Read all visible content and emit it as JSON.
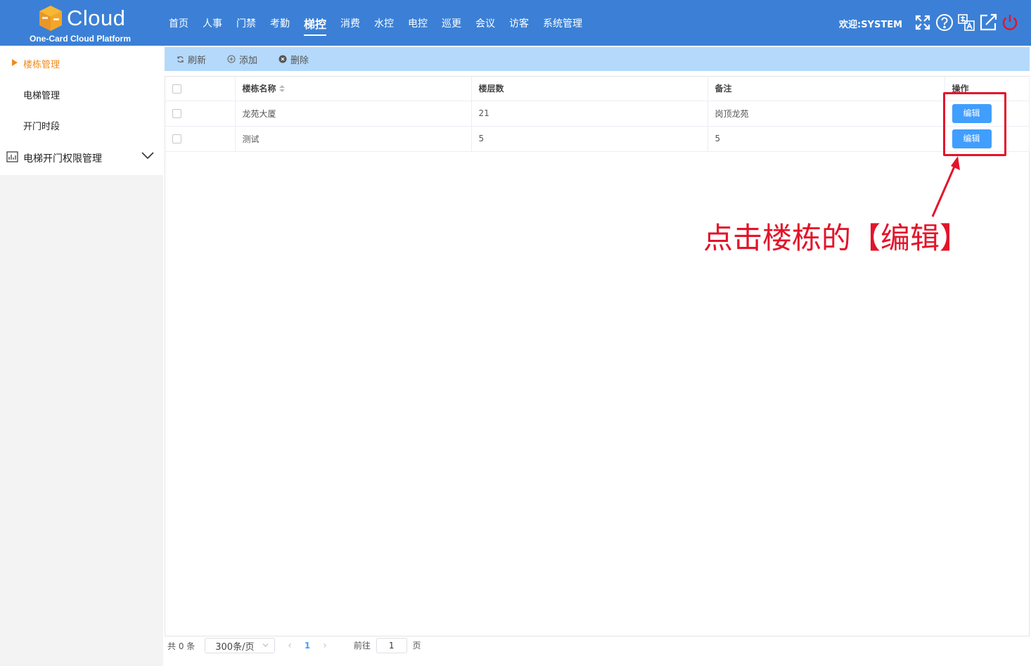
{
  "header": {
    "logo_word": "Cloud",
    "logo_sub": "One-Card Cloud Platform",
    "nav": [
      "首页",
      "人事",
      "门禁",
      "考勤",
      "梯控",
      "消费",
      "水控",
      "电控",
      "巡更",
      "会议",
      "访客",
      "系统管理"
    ],
    "active_nav": "梯控",
    "welcome": "欢迎:SYSTEM",
    "icons": [
      "fullscreen-icon",
      "help-icon",
      "language-icon",
      "open-external-icon",
      "power-icon"
    ]
  },
  "sidebar": {
    "items": [
      {
        "label": "楼栋管理",
        "active": true
      },
      {
        "label": "电梯管理",
        "active": false
      },
      {
        "label": "开门时段",
        "active": false
      }
    ],
    "group": {
      "label": "电梯开门权限管理",
      "icon": "chart-board-icon"
    }
  },
  "toolbar": {
    "refresh_label": "刷新",
    "add_label": "添加",
    "delete_label": "删除"
  },
  "table": {
    "columns": {
      "name": "楼栋名称",
      "floors": "楼层数",
      "remark": "备注",
      "ops": "操作"
    },
    "rows": [
      {
        "name": "龙苑大厦",
        "floors": "21",
        "remark": "岗顶龙苑",
        "action": "编辑"
      },
      {
        "name": "测试",
        "floors": "5",
        "remark": "5",
        "action": "编辑"
      }
    ]
  },
  "annotation": {
    "text": "点击楼栋的【编辑】",
    "color": "#e3142a"
  },
  "pagination": {
    "total": "共 0 条",
    "page_size": "300条/页",
    "current_page": "1",
    "goto_label": "前往",
    "goto_value": "1",
    "page_suffix": "页"
  },
  "colors": {
    "header_bg": "#3b80d6",
    "toolbar_bg": "#b5d9fa",
    "accent": "#409eff",
    "sidebar_active": "#f08a1d"
  }
}
